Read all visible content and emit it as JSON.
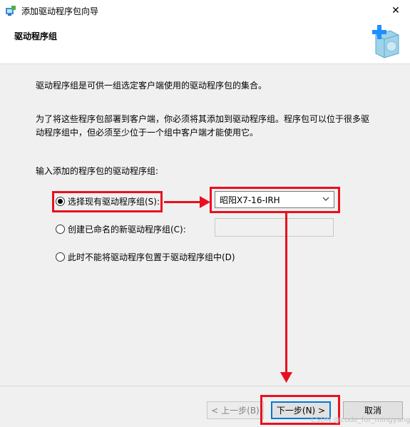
{
  "window": {
    "title": "添加驱动程序包向导",
    "close_glyph": "✕"
  },
  "header": {
    "title": "驱动程序组"
  },
  "body": {
    "description": "驱动程序组是可供一组选定客户端使用的驱动程序包的集合。",
    "note_line1": "为了将这些程序包部署到客户端，你必须将其添加到驱动程序组。程序包可以位于很多驱",
    "note_line2": "动程序组中，但必须至少位于一个组中客户端才能使用它。",
    "prompt": "输入添加的程序包的驱动程序组:"
  },
  "options": {
    "existing": {
      "label": "选择现有驱动程序组(S):",
      "selected": true,
      "value": "昭阳X7-16-IRH"
    },
    "new": {
      "label": "创建已命名的新驱动程序组(C):",
      "selected": false
    },
    "none": {
      "label": "此时不能将驱动程序包置于驱动程序组中(D)",
      "selected": false
    }
  },
  "footer": {
    "back_label": "< 上一步(B)",
    "next_label": "下一步(N) >",
    "cancel_label": "取消"
  },
  "watermark": "CSDN @code_for_mingyang",
  "colors": {
    "annotation": "#e8101f",
    "default_button_border": "#0078d7"
  }
}
